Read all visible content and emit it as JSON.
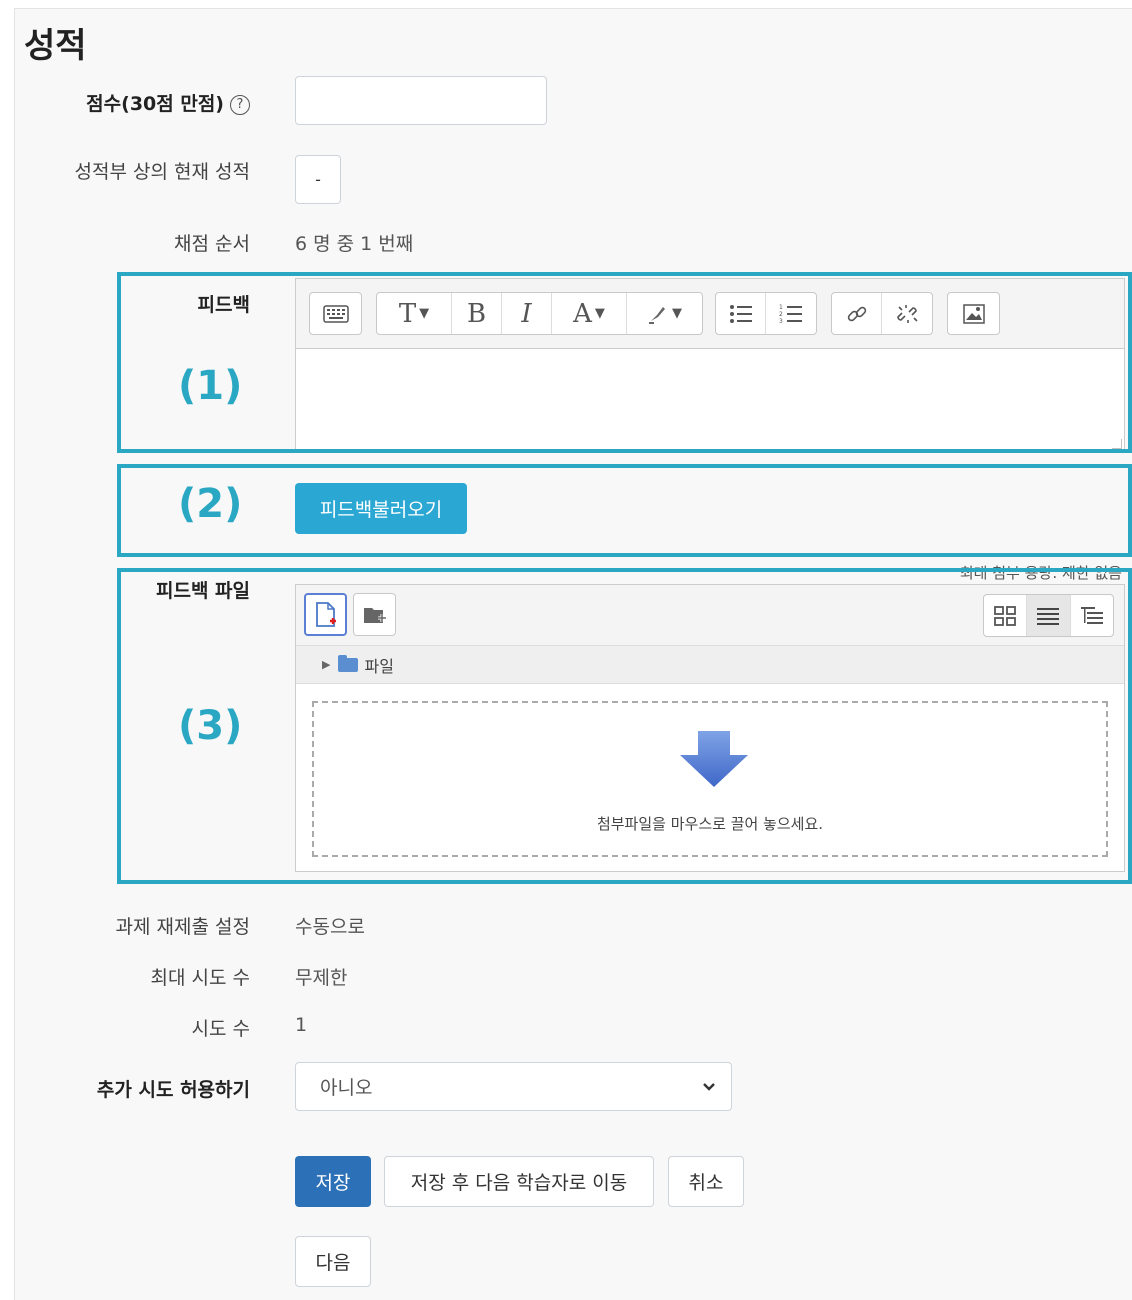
{
  "section_title": "성적",
  "score": {
    "label": "점수(30점 만점)",
    "help_glyph": "?",
    "value": ""
  },
  "gradebook": {
    "label": "성적부 상의 현재 성적",
    "value": "-"
  },
  "grading_order": {
    "label": "채점 순서",
    "value": "6 명 중 1 번째"
  },
  "feedback": {
    "label": "피드백"
  },
  "load_feedback_button": "피드백불러오기",
  "feedback_files": {
    "label": "피드백 파일",
    "limit": "최대 첨부 용량: 제한 없음",
    "folder_name": "파일",
    "drop_text": "첨부파일을 마우스로 끌어 놓으세요."
  },
  "resubmission": {
    "label": "과제 재제출 설정",
    "value": "수동으로"
  },
  "max_attempts": {
    "label": "최대 시도 수",
    "value": "무제한"
  },
  "attempts": {
    "label": "시도 수",
    "value": "1"
  },
  "allow_another": {
    "label": "추가 시도 허용하기",
    "selected": "아니오"
  },
  "buttons": {
    "save": "저장",
    "save_next": "저장 후 다음 학습자로 이동",
    "cancel": "취소",
    "next": "다음"
  },
  "annotations": [
    "(1)",
    "(2)",
    "(3)"
  ],
  "colors": {
    "annotation": "#2aa7c2",
    "primary": "#2c70b8",
    "cyan_button": "#2ba7d3"
  }
}
